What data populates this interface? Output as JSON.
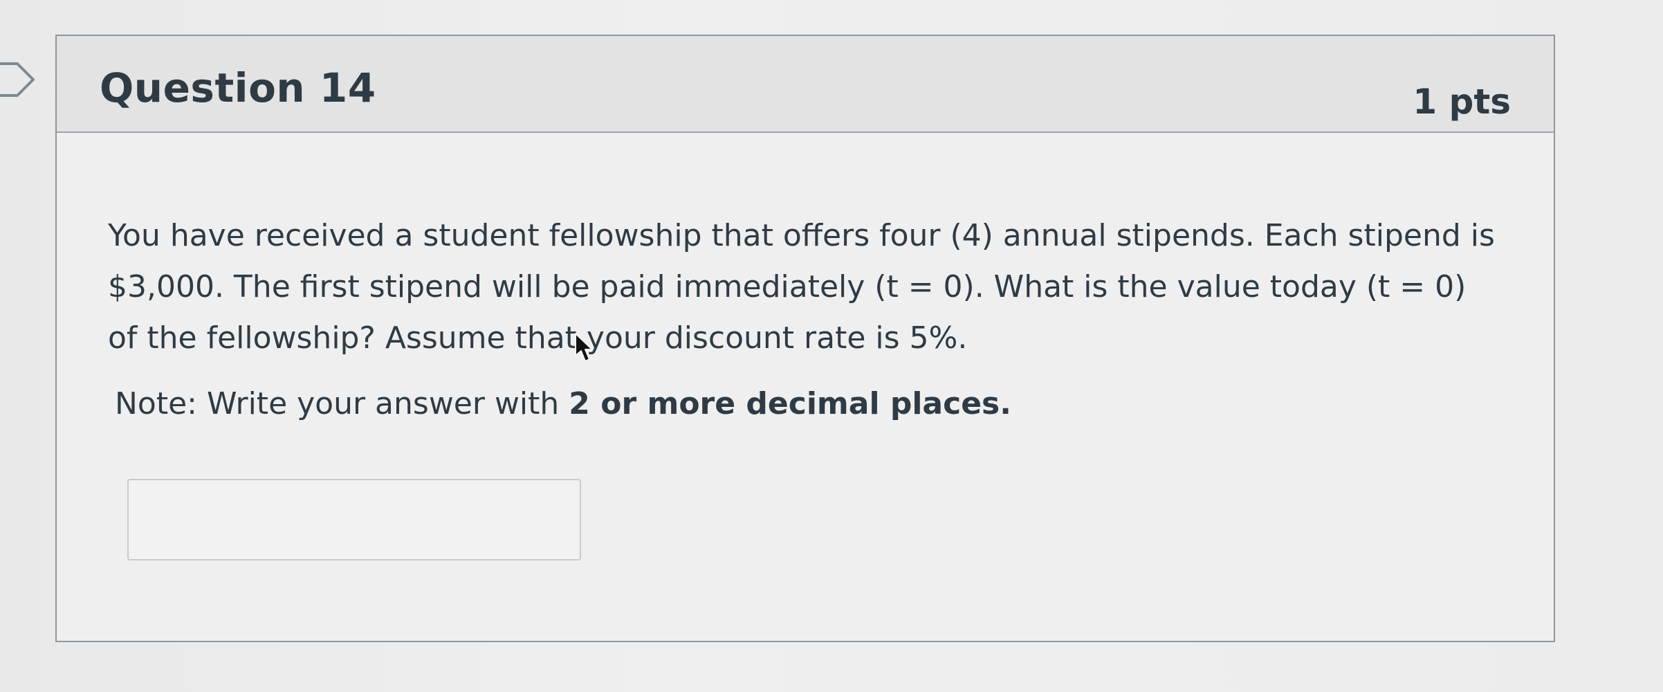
{
  "question": {
    "title": "Question 14",
    "points": "1 pts",
    "text": "You have received a student fellowship that offers four (4) annual stipends. Each stipend is $3,000. The first stipend will be paid immediately (t = 0). What is the value today (t = 0) of the fellowship? Assume that your discount rate is 5%.",
    "note_prefix": "Note: Write your answer with ",
    "note_emphasis": "2 or more decimal places.",
    "answer": {
      "value": "",
      "placeholder": ""
    }
  },
  "icons": {
    "flag": "question-flag-icon",
    "cursor": "mouse-cursor-icon"
  },
  "colors": {
    "background": "#eeeeee",
    "header_background": "#e3e3e3",
    "border": "#8e979d",
    "text": "#2f3b44",
    "input_border": "#c6cbcf"
  }
}
